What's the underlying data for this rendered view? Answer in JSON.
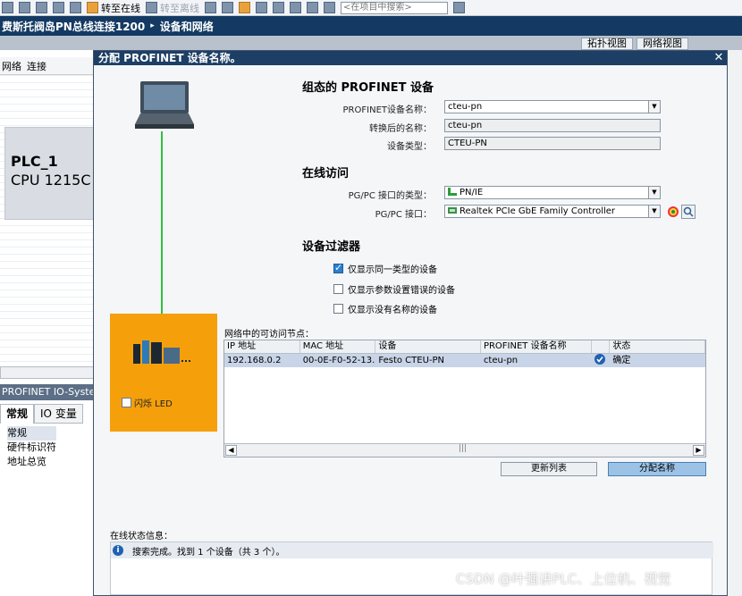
{
  "toolbar": {
    "go_online": "转至在线",
    "go_offline": "转至离线",
    "search_placeholder": "<在项目中搜索>"
  },
  "project": {
    "name": "费斯托阀岛PN总线连接1200",
    "separator": "▸",
    "section": "设备和网络"
  },
  "view_tabs": [
    "拓扑视图",
    "网络视图"
  ],
  "bg": {
    "tab_network": "网络",
    "tab_connect": "连接",
    "plc_name": "PLC_1",
    "plc_type": "CPU 1215C",
    "io_header": "PROFINET IO-System",
    "io_tabs": [
      "常规",
      "IO 变量"
    ],
    "io_list": [
      "常规",
      "硬件标识符",
      "地址总览"
    ]
  },
  "dialog": {
    "title": "分配 PROFINET 设备名称。",
    "close": "✕",
    "blink_led": "闪烁 LED",
    "section_config": "组态的 PROFINET 设备",
    "label_device_name": "PROFINET设备名称：",
    "device_name": "cteu-pn",
    "label_converted": "转换后的名称：",
    "converted_name": "cteu-pn",
    "label_device_type": "设备类型：",
    "device_type": "CTEU-PN",
    "section_online": "在线访问",
    "label_pgpc_type": "PG/PC 接口的类型：",
    "pgpc_type": "PN/IE",
    "label_pgpc_interface": "PG/PC 接口：",
    "pgpc_interface": "Realtek PCIe GbE Family Controller",
    "section_filter": "设备过滤器",
    "filter_same_type": "仅显示同一类型的设备",
    "filter_param_error": "仅显示参数设置错误的设备",
    "filter_no_name": "仅显示没有名称的设备",
    "filter_same_type_checked": true,
    "filter_param_error_checked": false,
    "filter_no_name_checked": false,
    "nodes_label": "网络中的可访问节点：",
    "table_headers": [
      "IP 地址",
      "MAC 地址",
      "设备",
      "PROFINET 设备名称",
      "",
      "状态"
    ],
    "table_rows": [
      [
        "192.168.0.2",
        "00-0E-F0-52-13...",
        "Festo CTEU-PN",
        "cteu-pn",
        "",
        "确定"
      ]
    ],
    "btn_refresh": "更新列表",
    "btn_assign": "分配名称",
    "status_label": "在线状态信息：",
    "status_message": "搜索完成。找到 1 个设备（共 3 个）。"
  },
  "watermark": "CSDN @叶强讲PLC、上位机、视觉",
  "colors": {
    "title_bar": "#1d3f66",
    "device_panel": "#f5a00b",
    "network_line": "#2fbf3f",
    "selected_row": "#c8d4e7",
    "primary_button": "#9cc3e6"
  }
}
